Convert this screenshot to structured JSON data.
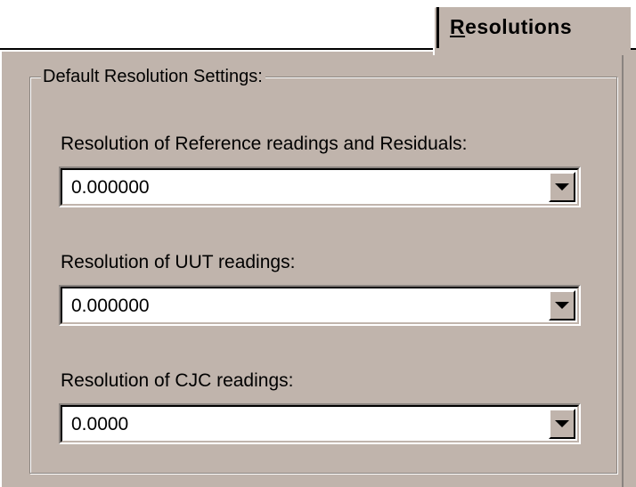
{
  "tab": {
    "accelerator": "R",
    "label_rest": "esolutions"
  },
  "group": {
    "title": "Default Resolution Settings:"
  },
  "fields": [
    {
      "label": "Resolution of Reference readings and Residuals:",
      "value": "0.000000",
      "button_icon": "chevron-down-icon"
    },
    {
      "label": "Resolution of UUT readings:",
      "value": "0.000000",
      "button_icon": "chevron-down-icon"
    },
    {
      "label": "Resolution of CJC readings:",
      "value": "0.0000",
      "button_icon": "chevron-down-icon"
    }
  ],
  "colors": {
    "face": "#c0b4ac",
    "field_bg": "#ffffff",
    "shadow": "#8a8480",
    "text": "#000000"
  }
}
